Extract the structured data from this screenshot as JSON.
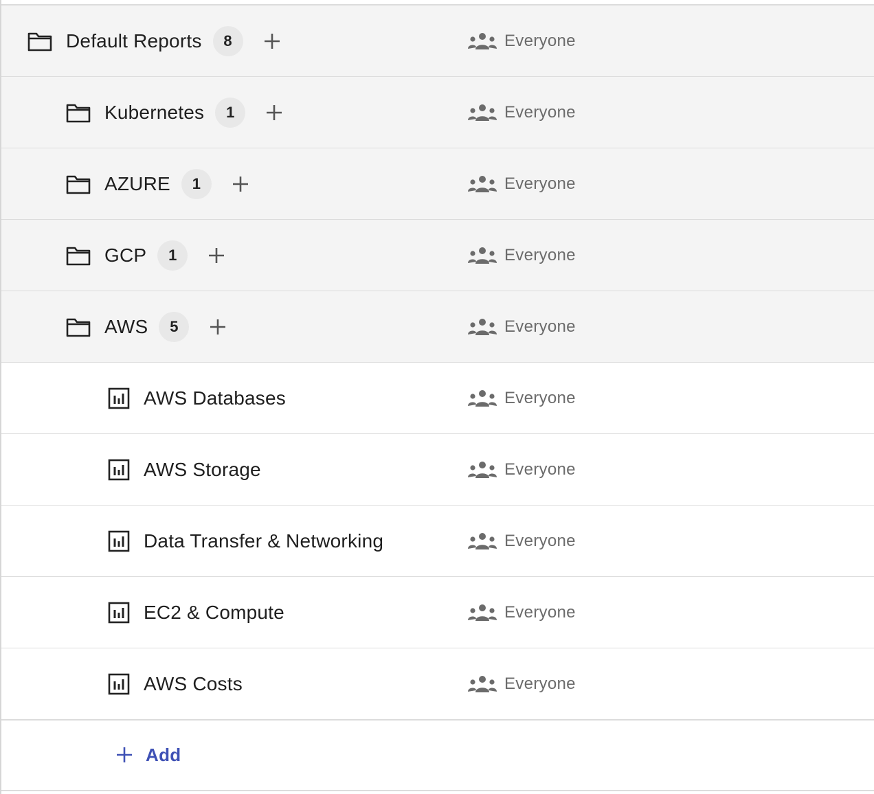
{
  "tree": {
    "root": {
      "label": "Default Reports",
      "count": "8",
      "sharing": "Everyone"
    },
    "folders": [
      {
        "label": "Kubernetes",
        "count": "1",
        "sharing": "Everyone"
      },
      {
        "label": "AZURE",
        "count": "1",
        "sharing": "Everyone"
      },
      {
        "label": "GCP",
        "count": "1",
        "sharing": "Everyone"
      },
      {
        "label": "AWS",
        "count": "5",
        "sharing": "Everyone"
      }
    ],
    "reports": [
      {
        "label": "AWS Databases",
        "sharing": "Everyone"
      },
      {
        "label": "AWS Storage",
        "sharing": "Everyone"
      },
      {
        "label": "Data Transfer & Networking",
        "sharing": "Everyone"
      },
      {
        "label": "EC2 & Compute",
        "sharing": "Everyone"
      },
      {
        "label": "AWS Costs",
        "sharing": "Everyone"
      }
    ],
    "add_label": "Add"
  },
  "icons": {
    "folder": "folder-icon",
    "report": "bar-chart-icon",
    "sharing": "people-group-icon",
    "add": "plus-icon"
  },
  "colors": {
    "folder_row_bg": "#f4f4f4",
    "accent": "#3f51b5",
    "muted_text": "#6b6b6b"
  }
}
